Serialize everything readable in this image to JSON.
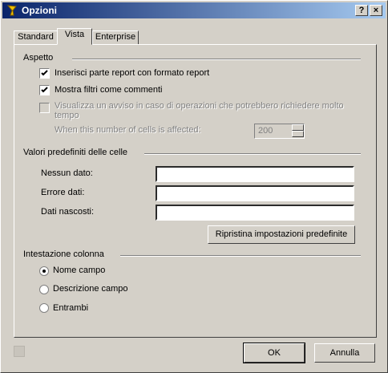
{
  "window": {
    "title": "Opzioni",
    "help_glyph": "?",
    "close_glyph": "×"
  },
  "tabs": [
    {
      "label": "Standard",
      "active": false
    },
    {
      "label": "Vista",
      "active": true
    },
    {
      "label": "Enterprise",
      "active": false
    }
  ],
  "aspetto": {
    "title": "Aspetto",
    "options": [
      {
        "label": "Inserisci parte report con formato report",
        "checked": true,
        "enabled": true
      },
      {
        "label": "Mostra filtri come commenti",
        "checked": true,
        "enabled": true
      },
      {
        "label_line1": "Visualizza un avviso in caso di operazioni che potrebbero richiedere molto",
        "label_line2": "tempo",
        "checked": false,
        "enabled": false
      }
    ],
    "cells_label": "When this number of cells is affected:",
    "cells_value": "200"
  },
  "valori": {
    "title": "Valori predefiniti delle celle",
    "fields": [
      {
        "label": "Nessun dato:",
        "value": ""
      },
      {
        "label": "Errore dati:",
        "value": ""
      },
      {
        "label": "Dati nascosti:",
        "value": ""
      }
    ],
    "reset_button": "Ripristina impostazioni predefinite"
  },
  "intestazione": {
    "title": "Intestazione colonna",
    "options": [
      {
        "label": "Nome campo",
        "selected": true
      },
      {
        "label": "Descrizione campo",
        "selected": false
      },
      {
        "label": "Entrambi",
        "selected": false
      }
    ]
  },
  "buttons": {
    "ok": "OK",
    "cancel": "Annulla"
  }
}
